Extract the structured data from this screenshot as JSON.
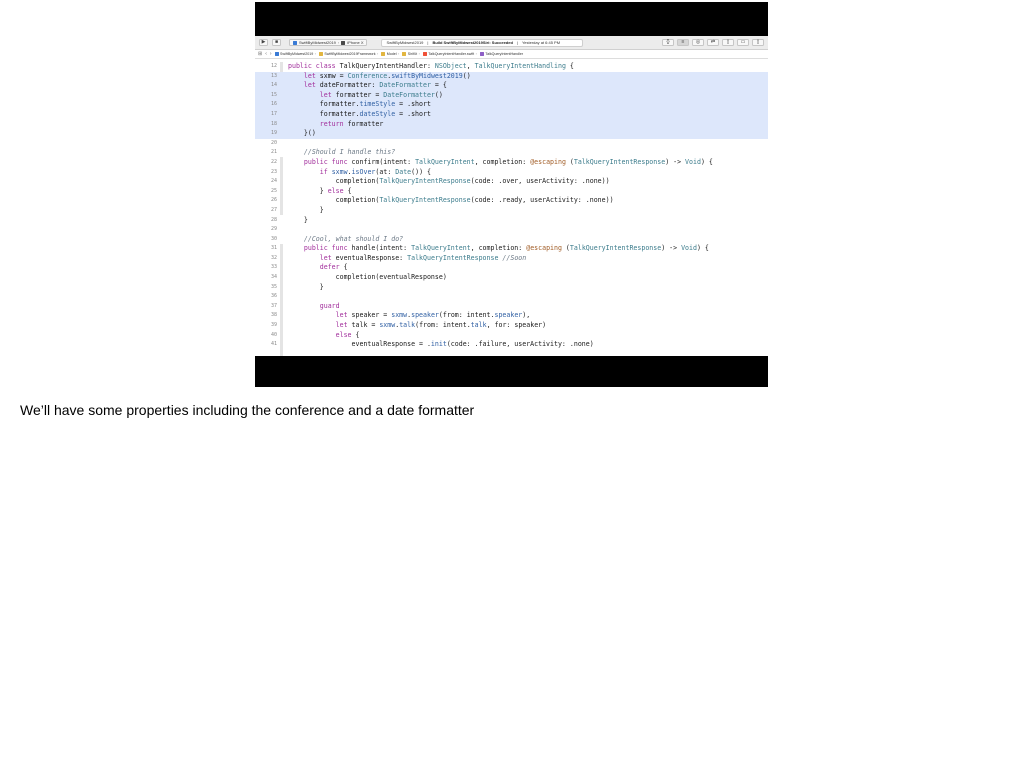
{
  "toolbar": {
    "scheme_target": "SwiftByMidwest2019",
    "scheme_device": "iPhone X",
    "status_project": "SwiftByMidwest2019",
    "status_build": "Build SwiftByMidwest2019Siri: Succeeded",
    "status_time": "Yesterday at 6:45 PM",
    "colors": {
      "app_square": "#3a7bd5",
      "device_square": "#4a4a4a"
    }
  },
  "jumpbar": {
    "crumbs": [
      {
        "label": "SwiftByMidwest2019",
        "icon": "project-icon"
      },
      {
        "label": "SwiftByMidwest2019Framework",
        "icon": "folder-icon"
      },
      {
        "label": "Model",
        "icon": "folder-icon"
      },
      {
        "label": "SiriKit",
        "icon": "folder-icon"
      },
      {
        "label": "TalkQueryIntentHandler.swift",
        "icon": "swift-file-icon"
      },
      {
        "label": "TalkQueryIntentHandler",
        "icon": "class-icon"
      }
    ]
  },
  "editor": {
    "line_numbers": [
      "12",
      "13",
      "14",
      "15",
      "16",
      "17",
      "18",
      "19",
      "20",
      "21",
      "22",
      "23",
      "24",
      "25",
      "26",
      "27",
      "28",
      "29",
      "30",
      "31",
      "32",
      "33",
      "34",
      "35",
      "36",
      "37",
      "38",
      "39",
      "40",
      "41"
    ],
    "highlighted_lines": [
      "13",
      "14",
      "15",
      "16",
      "17",
      "18",
      "19"
    ]
  },
  "caption": "We’ll have some properties including the conference and a date formatter"
}
